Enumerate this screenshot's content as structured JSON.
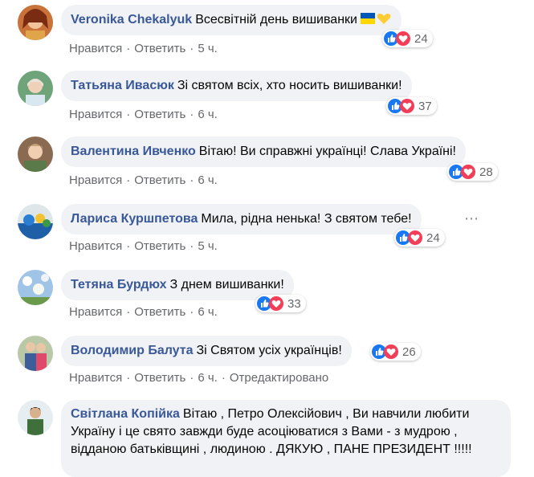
{
  "colors": {
    "link": "#385898",
    "like": "#1877f2",
    "love": "#f33e58",
    "meta": "#65676b",
    "bubble": "#f0f2f5"
  },
  "comments": [
    {
      "author": "Veronika Chekalyuk",
      "text": "Всесвітній день вишиванки",
      "emoji": "ua-flag-and-yellow-heart",
      "like": "Нравится",
      "reply": "Ответить",
      "time": "5 ч.",
      "reactions": "24",
      "edited": ""
    },
    {
      "author": "Татьяна Ивасюк",
      "text": "Зі святом всіх, хто носить вишиванки!",
      "like": "Нравится",
      "reply": "Ответить",
      "time": "6 ч.",
      "reactions": "37",
      "edited": ""
    },
    {
      "author": "Валентина Ивченко",
      "text": "Вітаю! Ви справжні українці! Слава Україні!",
      "like": "Нравится",
      "reply": "Ответить",
      "time": "6 ч.",
      "reactions": "28",
      "edited": ""
    },
    {
      "author": "Лариса Куршпетова",
      "text": "Мила, рідна ненька! З святом тебе!",
      "like": "Нравится",
      "reply": "Ответить",
      "time": "5 ч.",
      "reactions": "24",
      "edited": ""
    },
    {
      "author": "Тетяна Бурдюх",
      "text": "З днем вишиванки!",
      "like": "Нравится",
      "reply": "Ответить",
      "time": "6 ч.",
      "reactions": "33",
      "edited": ""
    },
    {
      "author": "Володимир Балута",
      "text": "Зі Святом усіх українців!",
      "like": "Нравится",
      "reply": "Ответить",
      "time": "6 ч.",
      "reactions": "26",
      "edited": "Отредактировано"
    },
    {
      "author": "Світлана Копійка",
      "text": "Вітаю , Петро Олексійович , Ви навчили любити Україну і це свято завжди буде асоціюватися з Вами - з мудрою , відданою батьківщині , людиною . ДЯКУЮ , ПАНЕ ПРЕЗИДЕНТ !!!!!"
    }
  ],
  "icons": {
    "like": "thumbs-up-icon",
    "love": "heart-icon",
    "more": "more-options-icon"
  }
}
